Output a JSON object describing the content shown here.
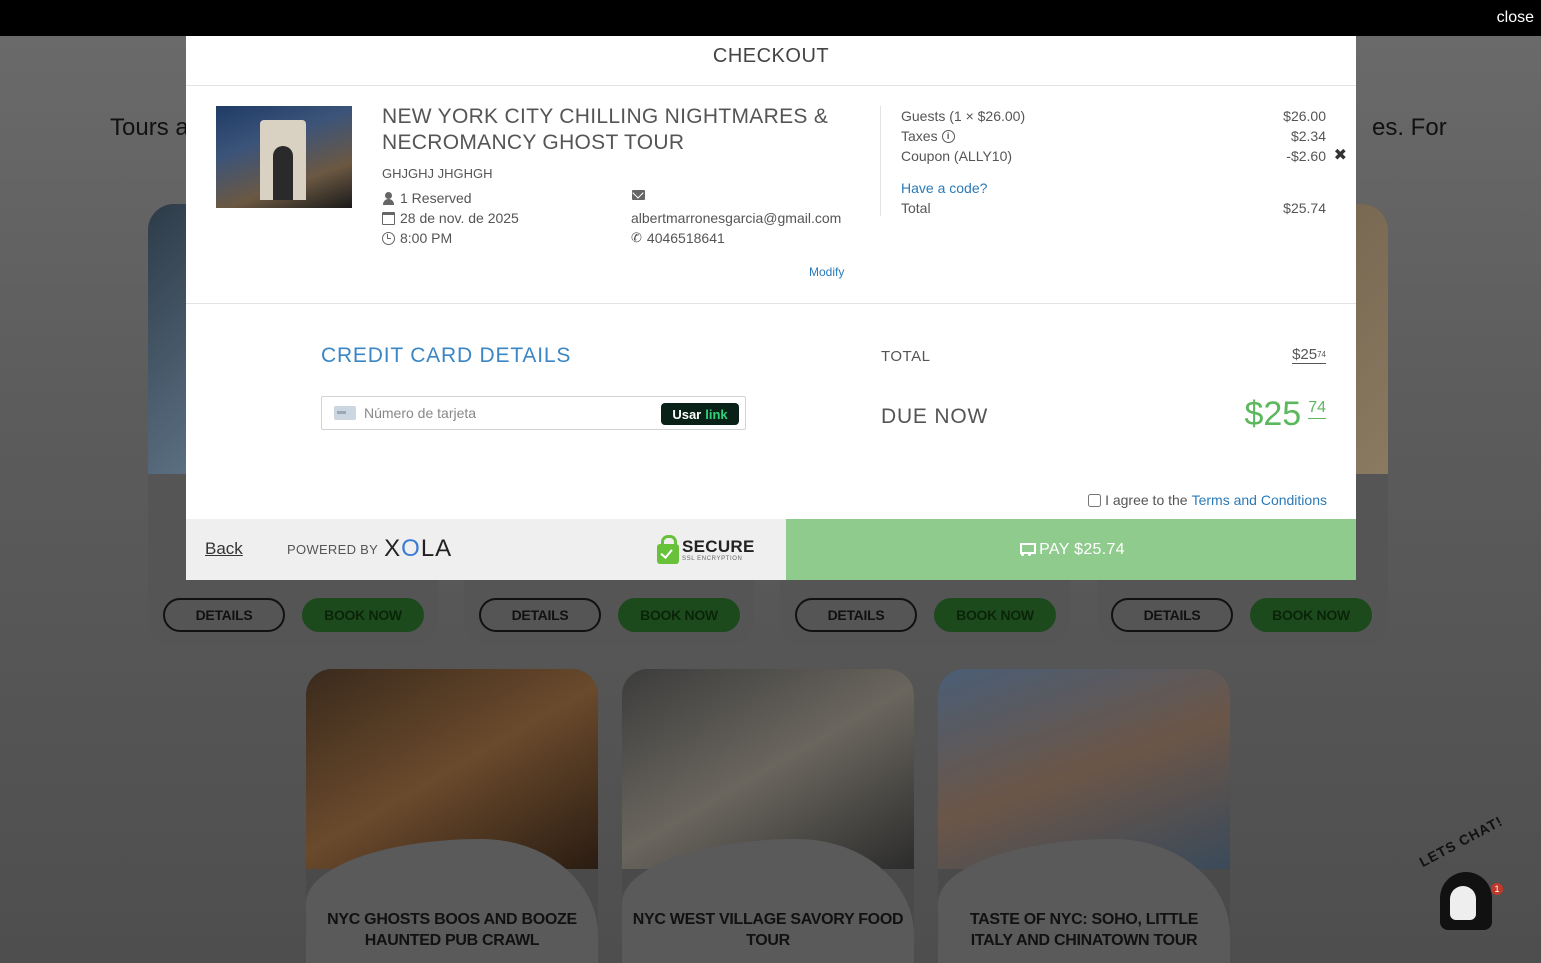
{
  "top_bar": {
    "close_label": "close"
  },
  "background": {
    "intro_left": "Tours a",
    "intro_right": "es. For",
    "cards_row1": [
      {
        "details_label": "DETAILS",
        "book_label": "BOOK NOW"
      },
      {
        "details_label": "DETAILS",
        "book_label": "BOOK NOW"
      },
      {
        "details_label": "DETAILS",
        "book_label": "BOOK NOW"
      },
      {
        "details_label": "DETAILS",
        "book_label": "BOOK NOW"
      }
    ],
    "cards_row2": [
      {
        "title": "NYC GHOSTS BOOS AND BOOZE HAUNTED PUB CRAWL"
      },
      {
        "title": "NYC WEST VILLAGE SAVORY FOOD TOUR"
      },
      {
        "title": "TASTE OF NYC: SOHO, LITTLE ITALY AND CHINATOWN TOUR"
      }
    ]
  },
  "checkout": {
    "header": "CHECKOUT",
    "tour": {
      "title": "NEW YORK CITY CHILLING NIGHTMARES & NECROMANCY GHOST TOUR",
      "guest_name": "GHJGHJ JHGHGH",
      "reserved": "1 Reserved",
      "date": "28 de nov. de 2025",
      "time": "8:00 PM",
      "email": "albertmarronesgarcia@gmail.com",
      "phone": "4046518641",
      "modify_label": "Modify"
    },
    "pricing": {
      "rows": [
        {
          "label": "Guests (1 × $26.00)",
          "value": "$26.00"
        },
        {
          "label": "Taxes",
          "value": "$2.34"
        },
        {
          "label": "Coupon (ALLY10)",
          "value": "-$2.60"
        }
      ],
      "have_code_label": "Have a code?",
      "total_label": "Total",
      "total_value": "$25.74"
    },
    "payment": {
      "title": "CREDIT CARD DETAILS",
      "card_placeholder": "Número de tarjeta",
      "link_button": {
        "use": "Usar",
        "link": "link"
      },
      "total_label": "TOTAL",
      "total_whole": "$25",
      "total_cents": "74",
      "due_label": "DUE NOW",
      "due_whole": "$25",
      "due_cents": "74",
      "agree_prefix": "I agree to the",
      "terms_label": "Terms and Conditions"
    },
    "footer": {
      "back_label": "Back",
      "powered_by": "POWERED BY",
      "xola_x": "X",
      "xola_o": "O",
      "xola_la": "LA",
      "secure_label": "SECURE",
      "secure_sub": "SSL ENCRYPTION",
      "pay_label": "PAY $25.74"
    }
  },
  "chat": {
    "label": "LETS CHAT!",
    "badge": "1"
  },
  "colors": {
    "accent_blue": "#3b86c4",
    "pay_green": "#8fcb8c",
    "due_green": "#5cb85c"
  }
}
